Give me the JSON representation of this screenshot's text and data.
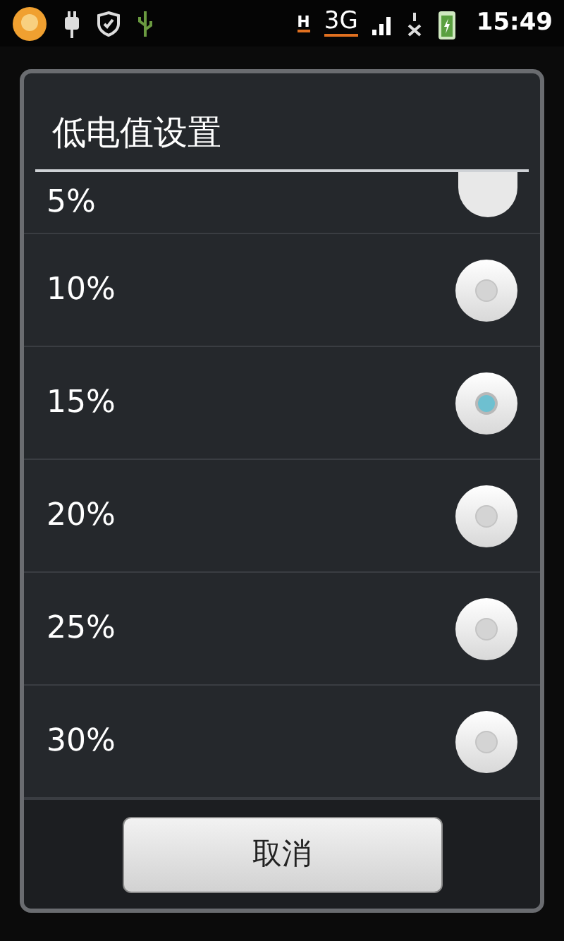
{
  "status_bar": {
    "network_type": "H",
    "mobile_data": "3G",
    "time": "15:49"
  },
  "dialog": {
    "title": "低电值设置",
    "options": [
      {
        "label": "5%",
        "selected": false
      },
      {
        "label": "10%",
        "selected": false
      },
      {
        "label": "15%",
        "selected": true
      },
      {
        "label": "20%",
        "selected": false
      },
      {
        "label": "25%",
        "selected": false
      },
      {
        "label": "30%",
        "selected": false
      }
    ],
    "cancel_button": "取消"
  }
}
